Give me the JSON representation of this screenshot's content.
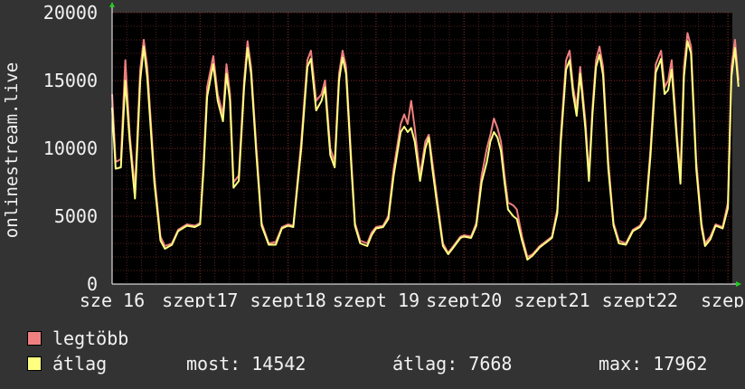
{
  "chart_data": {
    "type": "area",
    "title": "",
    "ylabel": "onlinestream.live",
    "xlabel": "",
    "ylim": [
      0,
      20000
    ],
    "y_ticks": [
      "0",
      "5000",
      "10000",
      "15000",
      "20000"
    ],
    "x_range": [
      16.0,
      23.05
    ],
    "x_ticks": [
      {
        "x": 16,
        "label": "sze 16"
      },
      {
        "x": 17,
        "label": "szept17"
      },
      {
        "x": 18,
        "label": "szept18"
      },
      {
        "x": 19,
        "label": "szept 19"
      },
      {
        "x": 20,
        "label": "szept20"
      },
      {
        "x": 21,
        "label": "szept21"
      },
      {
        "x": 22,
        "label": "szept22"
      },
      {
        "x": 23,
        "label": "szept"
      }
    ],
    "grid": true,
    "background": "#000000",
    "colors": {
      "max_series": "#f08080",
      "avg_series": "#ffff80",
      "grid": "#552222",
      "page": "#333333"
    },
    "series": [
      {
        "name": "legtöbb",
        "values": [
          [
            16.0,
            14000
          ],
          [
            16.04,
            9000
          ],
          [
            16.1,
            9200
          ],
          [
            16.15,
            16500
          ],
          [
            16.2,
            11000
          ],
          [
            16.26,
            7000
          ],
          [
            16.32,
            15800
          ],
          [
            16.36,
            18000
          ],
          [
            16.4,
            16000
          ],
          [
            16.48,
            8000
          ],
          [
            16.55,
            3500
          ],
          [
            16.6,
            2800
          ],
          [
            16.68,
            3000
          ],
          [
            16.75,
            4000
          ],
          [
            16.85,
            4400
          ],
          [
            16.94,
            4300
          ],
          [
            17.0,
            4500
          ],
          [
            17.04,
            9000
          ],
          [
            17.08,
            14500
          ],
          [
            17.15,
            16800
          ],
          [
            17.2,
            14000
          ],
          [
            17.26,
            12500
          ],
          [
            17.3,
            16200
          ],
          [
            17.34,
            14000
          ],
          [
            17.38,
            7500
          ],
          [
            17.44,
            8000
          ],
          [
            17.5,
            15000
          ],
          [
            17.54,
            17900
          ],
          [
            17.58,
            16000
          ],
          [
            17.64,
            10000
          ],
          [
            17.7,
            4500
          ],
          [
            17.78,
            3000
          ],
          [
            17.86,
            3100
          ],
          [
            17.93,
            4200
          ],
          [
            18.0,
            4400
          ],
          [
            18.06,
            4300
          ],
          [
            18.15,
            10500
          ],
          [
            18.22,
            16500
          ],
          [
            18.26,
            17200
          ],
          [
            18.32,
            13500
          ],
          [
            18.38,
            14000
          ],
          [
            18.42,
            15000
          ],
          [
            18.48,
            10000
          ],
          [
            18.53,
            9000
          ],
          [
            18.58,
            15500
          ],
          [
            18.62,
            17200
          ],
          [
            18.66,
            16000
          ],
          [
            18.72,
            9000
          ],
          [
            18.76,
            4500
          ],
          [
            18.82,
            3200
          ],
          [
            18.9,
            3000
          ],
          [
            18.95,
            3800
          ],
          [
            19.0,
            4200
          ],
          [
            19.08,
            4300
          ],
          [
            19.14,
            5000
          ],
          [
            19.2,
            8500
          ],
          [
            19.28,
            11800
          ],
          [
            19.32,
            12500
          ],
          [
            19.36,
            11800
          ],
          [
            19.4,
            13500
          ],
          [
            19.44,
            11500
          ],
          [
            19.5,
            8000
          ],
          [
            19.56,
            10500
          ],
          [
            19.6,
            11000
          ],
          [
            19.64,
            9000
          ],
          [
            19.7,
            6000
          ],
          [
            19.76,
            3000
          ],
          [
            19.82,
            2300
          ],
          [
            19.88,
            2800
          ],
          [
            19.96,
            3500
          ],
          [
            20.0,
            3600
          ],
          [
            20.08,
            3500
          ],
          [
            20.14,
            4500
          ],
          [
            20.2,
            8000
          ],
          [
            20.26,
            10000
          ],
          [
            20.3,
            11000
          ],
          [
            20.34,
            12200
          ],
          [
            20.38,
            11500
          ],
          [
            20.42,
            10500
          ],
          [
            20.46,
            8000
          ],
          [
            20.5,
            6000
          ],
          [
            20.56,
            5800
          ],
          [
            20.6,
            5500
          ],
          [
            20.66,
            3500
          ],
          [
            20.72,
            2000
          ],
          [
            20.78,
            2200
          ],
          [
            20.86,
            2800
          ],
          [
            20.94,
            3200
          ],
          [
            21.0,
            3500
          ],
          [
            21.06,
            5500
          ],
          [
            21.1,
            11000
          ],
          [
            21.16,
            16500
          ],
          [
            21.2,
            17200
          ],
          [
            21.24,
            14500
          ],
          [
            21.28,
            13000
          ],
          [
            21.32,
            16000
          ],
          [
            21.38,
            12000
          ],
          [
            21.42,
            8000
          ],
          [
            21.46,
            13000
          ],
          [
            21.5,
            16500
          ],
          [
            21.54,
            17500
          ],
          [
            21.58,
            16000
          ],
          [
            21.64,
            9000
          ],
          [
            21.7,
            4500
          ],
          [
            21.76,
            3200
          ],
          [
            21.84,
            3000
          ],
          [
            21.92,
            4000
          ],
          [
            22.0,
            4300
          ],
          [
            22.06,
            5000
          ],
          [
            22.12,
            10000
          ],
          [
            22.18,
            16200
          ],
          [
            22.24,
            17200
          ],
          [
            22.28,
            14500
          ],
          [
            22.32,
            15000
          ],
          [
            22.36,
            16500
          ],
          [
            22.42,
            11000
          ],
          [
            22.46,
            8000
          ],
          [
            22.5,
            16000
          ],
          [
            22.54,
            18500
          ],
          [
            22.58,
            17500
          ],
          [
            22.64,
            9000
          ],
          [
            22.7,
            4500
          ],
          [
            22.74,
            3000
          ],
          [
            22.8,
            3500
          ],
          [
            22.86,
            4400
          ],
          [
            22.94,
            4200
          ],
          [
            23.0,
            6000
          ],
          [
            23.04,
            16000
          ],
          [
            23.08,
            18000
          ],
          [
            23.12,
            15000
          ]
        ]
      },
      {
        "name": "átlag",
        "values": [
          [
            16.0,
            13000
          ],
          [
            16.04,
            8500
          ],
          [
            16.1,
            8600
          ],
          [
            16.15,
            15000
          ],
          [
            16.2,
            10500
          ],
          [
            16.26,
            6300
          ],
          [
            16.32,
            15000
          ],
          [
            16.36,
            17500
          ],
          [
            16.4,
            15200
          ],
          [
            16.48,
            7500
          ],
          [
            16.55,
            3200
          ],
          [
            16.6,
            2600
          ],
          [
            16.68,
            2900
          ],
          [
            16.75,
            3900
          ],
          [
            16.85,
            4300
          ],
          [
            16.94,
            4200
          ],
          [
            17.0,
            4400
          ],
          [
            17.04,
            8500
          ],
          [
            17.08,
            13800
          ],
          [
            17.15,
            16200
          ],
          [
            17.2,
            13500
          ],
          [
            17.26,
            12000
          ],
          [
            17.3,
            15500
          ],
          [
            17.34,
            13500
          ],
          [
            17.38,
            7100
          ],
          [
            17.44,
            7600
          ],
          [
            17.5,
            14500
          ],
          [
            17.54,
            17400
          ],
          [
            17.58,
            15500
          ],
          [
            17.64,
            9500
          ],
          [
            17.7,
            4300
          ],
          [
            17.78,
            2900
          ],
          [
            17.86,
            2900
          ],
          [
            17.93,
            4100
          ],
          [
            18.0,
            4300
          ],
          [
            18.06,
            4200
          ],
          [
            18.15,
            10000
          ],
          [
            18.22,
            16000
          ],
          [
            18.26,
            16600
          ],
          [
            18.32,
            12800
          ],
          [
            18.38,
            13500
          ],
          [
            18.42,
            14500
          ],
          [
            18.48,
            9500
          ],
          [
            18.53,
            8600
          ],
          [
            18.58,
            15000
          ],
          [
            18.62,
            16700
          ],
          [
            18.66,
            15500
          ],
          [
            18.72,
            8500
          ],
          [
            18.76,
            4300
          ],
          [
            18.82,
            3000
          ],
          [
            18.9,
            2800
          ],
          [
            18.95,
            3600
          ],
          [
            19.0,
            4100
          ],
          [
            19.08,
            4200
          ],
          [
            19.14,
            4800
          ],
          [
            19.2,
            8000
          ],
          [
            19.28,
            11200
          ],
          [
            19.32,
            11600
          ],
          [
            19.36,
            11200
          ],
          [
            19.4,
            11500
          ],
          [
            19.44,
            10500
          ],
          [
            19.5,
            7600
          ],
          [
            19.56,
            10000
          ],
          [
            19.6,
            10800
          ],
          [
            19.64,
            8500
          ],
          [
            19.7,
            5600
          ],
          [
            19.76,
            2800
          ],
          [
            19.82,
            2200
          ],
          [
            19.88,
            2700
          ],
          [
            19.96,
            3400
          ],
          [
            20.0,
            3500
          ],
          [
            20.08,
            3400
          ],
          [
            20.14,
            4300
          ],
          [
            20.2,
            7500
          ],
          [
            20.26,
            9000
          ],
          [
            20.3,
            10500
          ],
          [
            20.34,
            11200
          ],
          [
            20.38,
            10800
          ],
          [
            20.42,
            9800
          ],
          [
            20.46,
            7500
          ],
          [
            20.5,
            5500
          ],
          [
            20.56,
            5000
          ],
          [
            20.6,
            4800
          ],
          [
            20.66,
            3200
          ],
          [
            20.72,
            1800
          ],
          [
            20.78,
            2100
          ],
          [
            20.86,
            2700
          ],
          [
            20.94,
            3100
          ],
          [
            21.0,
            3400
          ],
          [
            21.06,
            5200
          ],
          [
            21.1,
            10500
          ],
          [
            21.16,
            15800
          ],
          [
            21.2,
            16500
          ],
          [
            21.24,
            14000
          ],
          [
            21.28,
            12400
          ],
          [
            21.32,
            15500
          ],
          [
            21.38,
            11400
          ],
          [
            21.42,
            7600
          ],
          [
            21.46,
            12500
          ],
          [
            21.5,
            16000
          ],
          [
            21.54,
            16900
          ],
          [
            21.58,
            15400
          ],
          [
            21.64,
            8500
          ],
          [
            21.7,
            4300
          ],
          [
            21.76,
            3000
          ],
          [
            21.84,
            2900
          ],
          [
            21.92,
            3900
          ],
          [
            22.0,
            4200
          ],
          [
            22.06,
            4800
          ],
          [
            22.12,
            9500
          ],
          [
            22.18,
            15600
          ],
          [
            22.24,
            16600
          ],
          [
            22.28,
            14000
          ],
          [
            22.32,
            14300
          ],
          [
            22.36,
            15800
          ],
          [
            22.42,
            10500
          ],
          [
            22.46,
            7400
          ],
          [
            22.5,
            15300
          ],
          [
            22.54,
            17900
          ],
          [
            22.58,
            17000
          ],
          [
            22.64,
            8500
          ],
          [
            22.7,
            4200
          ],
          [
            22.74,
            2800
          ],
          [
            22.8,
            3300
          ],
          [
            22.86,
            4300
          ],
          [
            22.94,
            4100
          ],
          [
            23.0,
            5600
          ],
          [
            23.04,
            15300
          ],
          [
            23.08,
            17400
          ],
          [
            23.12,
            14542
          ]
        ]
      }
    ]
  },
  "legend": [
    {
      "label": "legtöbb",
      "color": "#f08080"
    },
    {
      "label": "átlag",
      "color": "#ffff80"
    }
  ],
  "stats": {
    "current": "most: 14542",
    "average": "átlag: 7668",
    "max": "max: 17962"
  }
}
